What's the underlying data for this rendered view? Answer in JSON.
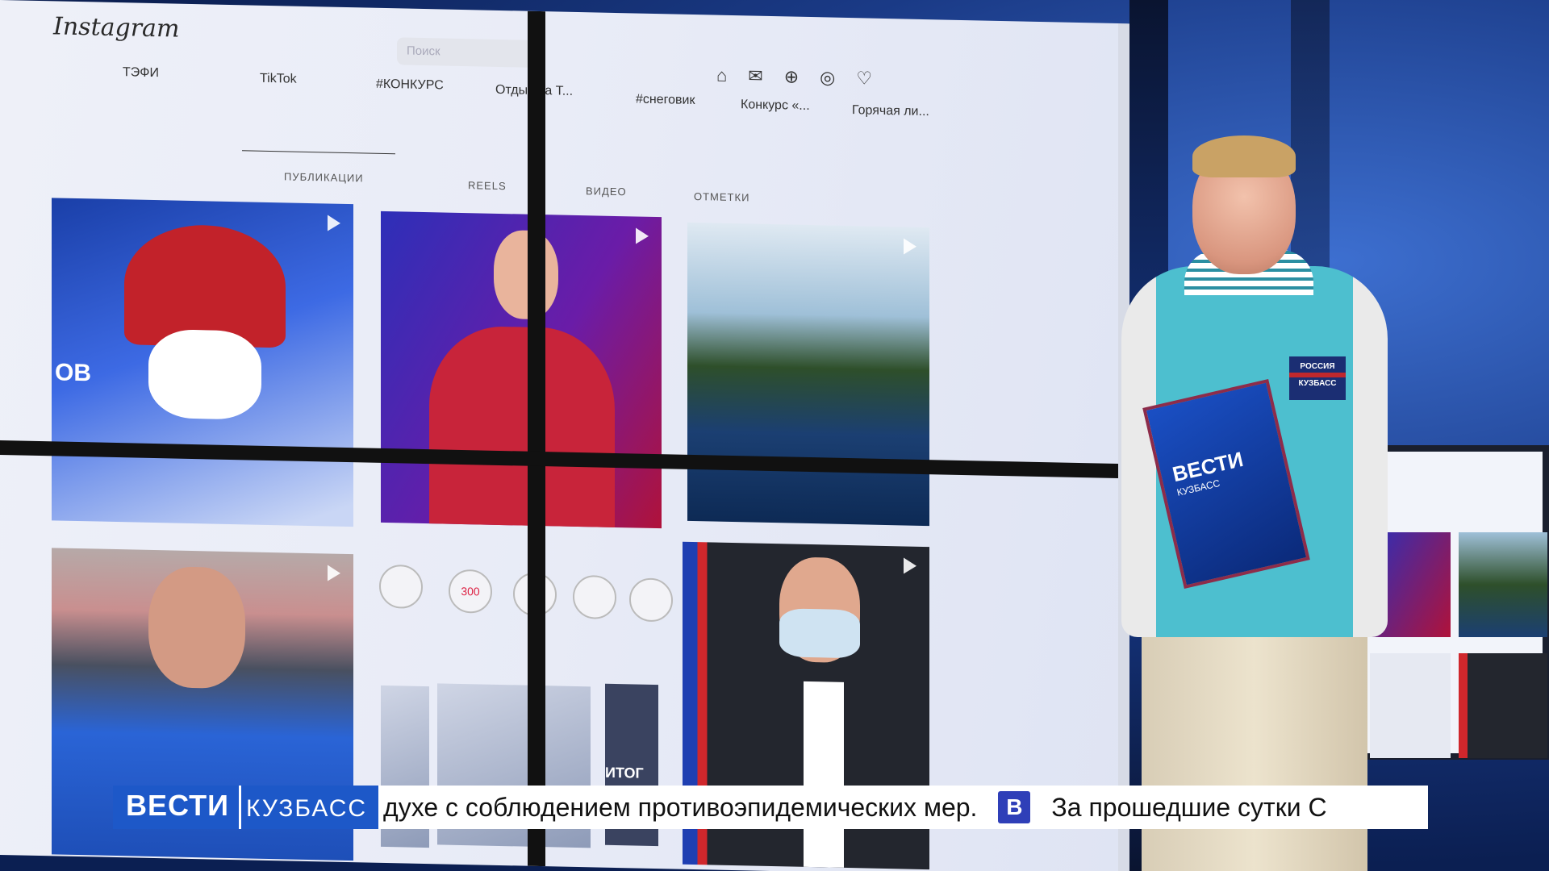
{
  "screen": {
    "logo": "Instagram",
    "search_placeholder": "Поиск",
    "top_icons": [
      "home-icon",
      "messenger-icon",
      "new-post-icon",
      "explore-icon",
      "heart-icon"
    ],
    "highlights": [
      "ТЭФИ",
      "TikTok",
      "#КОНКУРС",
      "Отдых на Т...",
      "#снеговик",
      "Конкурс «...",
      "Горячая ли..."
    ],
    "tabs": [
      "ПУБЛИКАЦИИ",
      "REELS",
      "ВИДЕО",
      "ОТМЕТКИ"
    ],
    "post1_text": "ОВ",
    "post2_story_300": "300",
    "post_itog": "ИТОГ"
  },
  "presenter": {
    "folder_brand": "ВЕСТИ",
    "folder_sub": "КУЗБАСС",
    "badge_line1": "РОССИЯ",
    "badge_line2": "КУЗБАСС"
  },
  "ticker": {
    "brand_main": "ВЕСТИ",
    "brand_region": "КУЗБАСС",
    "text": "духе с соблюдением противоэпидемических мер.",
    "separator": "В",
    "next_text": "За прошедшие сутки С"
  }
}
